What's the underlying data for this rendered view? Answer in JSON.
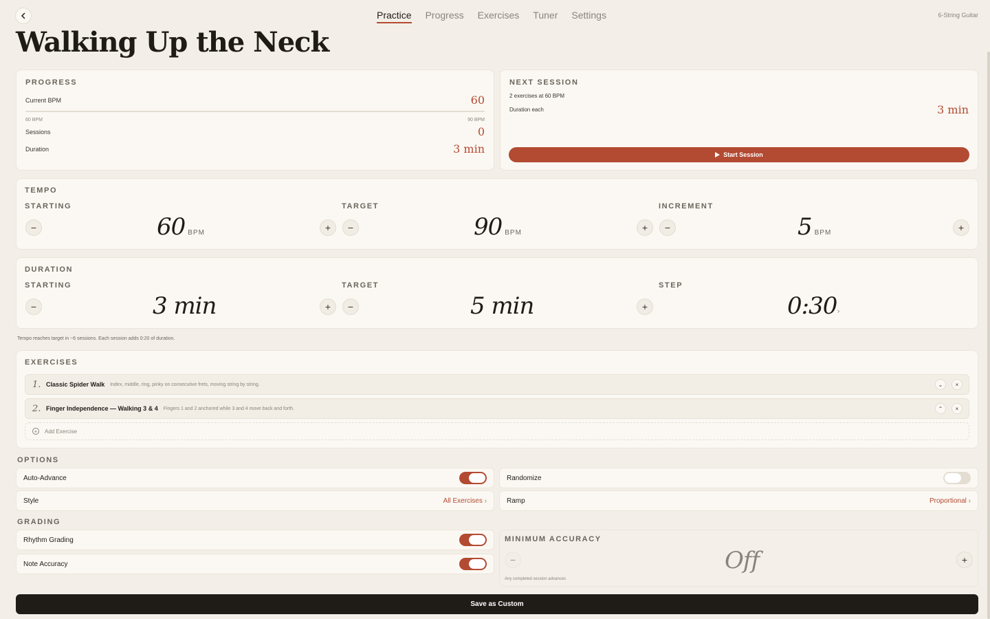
{
  "header": {
    "back_icon": "chevron-left-icon",
    "tabs": [
      {
        "label": "Practice",
        "active": true
      },
      {
        "label": "Progress",
        "active": false
      },
      {
        "label": "Exercises",
        "active": false
      },
      {
        "label": "Tuner",
        "active": false
      },
      {
        "label": "Settings",
        "active": false
      }
    ],
    "instrument": "6-String Guitar",
    "title": "Walking Up the Neck"
  },
  "progress": {
    "label": "PROGRESS",
    "current_bpm_label": "Current BPM",
    "current_bpm": "60",
    "range_min": "60 BPM",
    "range_max": "90 BPM",
    "sessions_label": "Sessions",
    "sessions": "0",
    "duration_label": "Duration",
    "duration": "3 min"
  },
  "next_session": {
    "label": "NEXT SESSION",
    "summary": "2 exercises at 60 BPM",
    "duration_label": "Duration each",
    "duration": "3 min",
    "start_label": "Start Session"
  },
  "tempo": {
    "label": "TEMPO",
    "starting_label": "STARTING",
    "starting": "60",
    "target_label": "TARGET",
    "target": "90",
    "increment_label": "INCREMENT",
    "increment": "5",
    "unit": "BPM"
  },
  "duration": {
    "label": "DURATION",
    "starting_label": "STARTING",
    "starting": "3 min",
    "target_label": "TARGET",
    "target": "5 min",
    "step_label": "STEP",
    "step": "0:30"
  },
  "hint": "Tempo reaches target in ~6 sessions. Each session adds 0:20 of duration.",
  "exercises": {
    "label": "EXERCISES",
    "items": [
      {
        "num": "1.",
        "name": "Classic Spider Walk",
        "desc": "Index, middle, ring, pinky on consecutive frets, moving string by string."
      },
      {
        "num": "2.",
        "name": "Finger Independence — Walking 3 & 4",
        "desc": "Fingers 1 and 2 anchored while 3 and 4 move back and forth."
      }
    ],
    "add_label": "Add Exercise"
  },
  "options": {
    "label": "OPTIONS",
    "auto_advance_label": "Auto-Advance",
    "randomize_label": "Randomize",
    "style_label": "Style",
    "style_value": "All Exercises",
    "ramp_label": "Ramp",
    "ramp_value": "Proportional"
  },
  "grading": {
    "label": "GRADING",
    "rhythm_label": "Rhythm Grading",
    "note_label": "Note Accuracy",
    "min_accuracy_label": "MINIMUM ACCURACY",
    "min_accuracy_value": "Off",
    "min_accuracy_hint": "Any completed session advances"
  },
  "save_label": "Save as Custom",
  "colors": {
    "accent": "#b34a32",
    "background": "#f3efe8",
    "card": "#fbf8f3",
    "dark": "#1f1b17"
  }
}
